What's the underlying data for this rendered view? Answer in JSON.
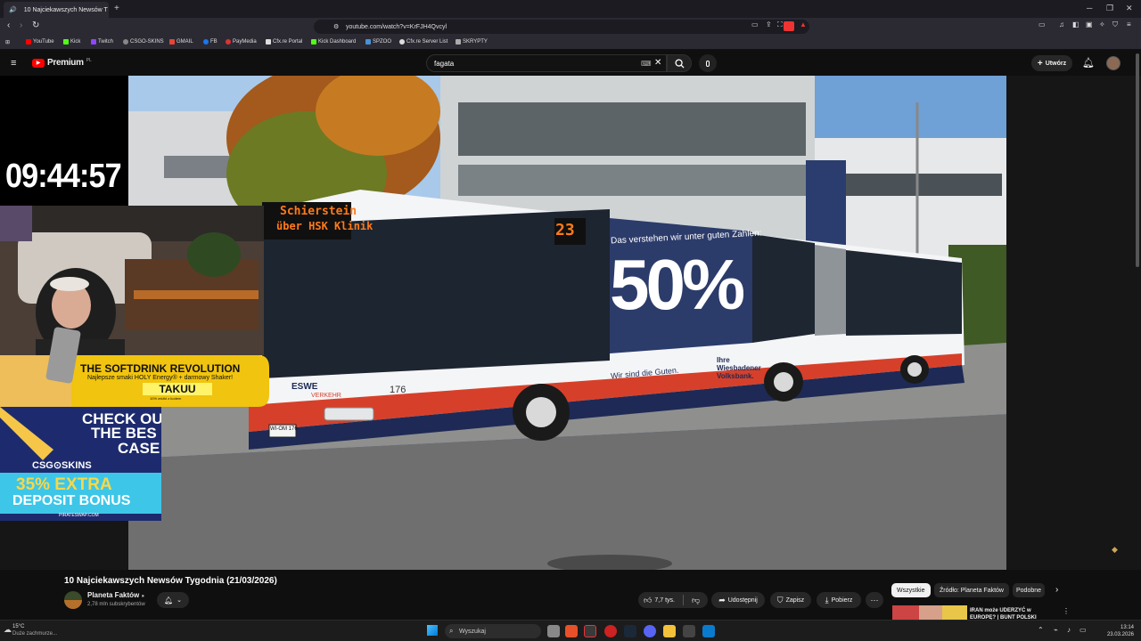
{
  "browser": {
    "tab_title": "10 Najciekawszych Newsów T",
    "url": "youtube.com/watch?v=KrFJH4Qvcyl",
    "bookmarks": [
      "YouTube",
      "Kick",
      "Twitch",
      "CSGO-SKINS",
      "GMAIL",
      "FB",
      "PayMedia",
      "Cfx.re Portal",
      "Kick Dashboard",
      "SPZOO",
      "Cfx.re Server List",
      "SKRYPTY"
    ]
  },
  "youtube": {
    "logo": "Premium",
    "logo_region": "PL",
    "search_value": "fagata",
    "create_label": "Utwórz"
  },
  "overlay": {
    "clock": "09:44:57",
    "ad1_title": "THE SOFTDRINK REVOLUTION",
    "ad1_sub": "Najlepsze smaki HOLY Energy® + darmowy Shaker!",
    "ad1_code": "TAKUU",
    "ad1_small": "10% zniżki z kodem",
    "ad2_line1": "CHECK OU",
    "ad2_line2": "THE BES",
    "ad2_line3": "CASE",
    "ad2_brand": "CSG⊙SKINS",
    "ad2_bonus1": "35% EXTRA",
    "ad2_bonus2": "DEPOSIT BONUS",
    "ad2_site": "PIRATESWAP.COM"
  },
  "bus": {
    "destination1": "Schierstein",
    "destination2": "über HSK Klinik",
    "route": "23",
    "ad_headline": "Das verstehen wir unter guten Zahlen:",
    "ad_percent": "50%",
    "ad_slogan": "Wir sind die Guten.",
    "ad_bank": "Ihre Wiesbadener Volksbank.",
    "operator": "ESWE",
    "operator_sub": "VERKEHR",
    "fleet_number": "176",
    "plate": "WI-OM 176"
  },
  "video": {
    "title": "10 Najciekawszych Newsów Tygodnia (21/03/2026)",
    "channel": "Planeta Faktów",
    "subscribers": "2,78 mln subskrybentów",
    "likes": "7,7 tys.",
    "share_label": "Udostępnij",
    "save_label": "Zapisz",
    "download_label": "Pobierz"
  },
  "chips": [
    "Wszystkie",
    "Źródło: Planeta Faktów",
    "Podobne"
  ],
  "recommendation": {
    "title": "IRAN może UDERZYĆ w EUROPĘ? | BUNT POLSKI"
  },
  "taskbar": {
    "temp": "15°C",
    "weather": "Duże zachmurze...",
    "search": "Wyszukaj",
    "time": "13:14",
    "date": "23.03.2026"
  }
}
